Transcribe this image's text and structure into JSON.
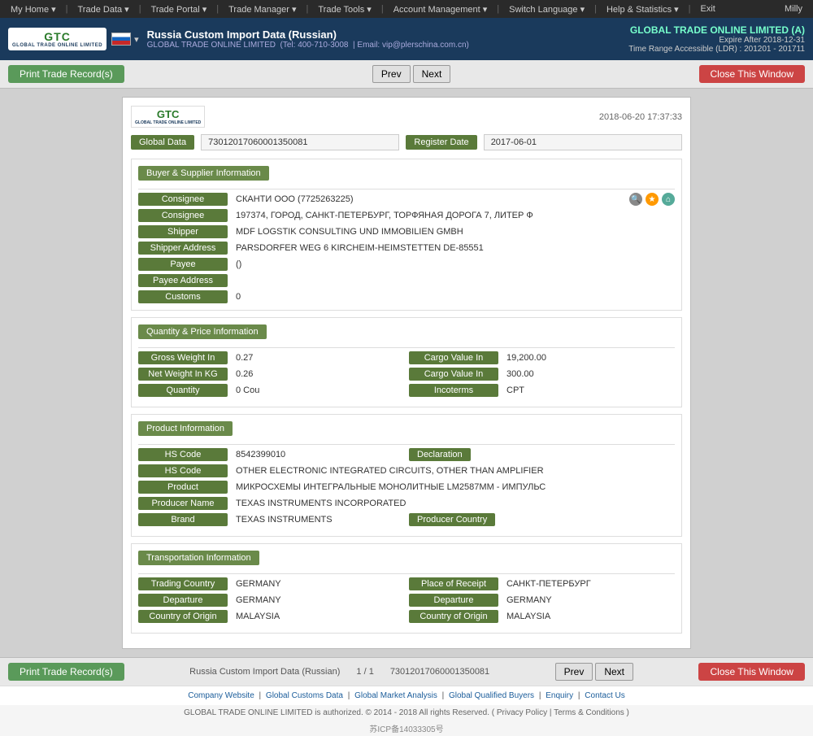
{
  "topnav": {
    "items": [
      "My Home",
      "Trade Data",
      "Trade Portal",
      "Trade Manager",
      "Trade Tools",
      "Account Management",
      "Switch Language",
      "Help & Statistics",
      "Exit"
    ],
    "user": "Milly"
  },
  "header": {
    "country_title": "Russia Custom Import Data (Russian)",
    "company_name": "GLOBAL TRADE ONLINE LIMITED",
    "tel": "Tel: 400-710-3008",
    "email": "Email: vip@plerschina.com.cn",
    "gto_link": "GLOBAL TRADE ONLINE LIMITED (A)",
    "expire": "Expire After 2018-12-31",
    "time_range": "Time Range Accessible (LDR) : 201201 - 201711"
  },
  "toolbar": {
    "print_btn": "Print Trade Record(s)",
    "prev_btn": "Prev",
    "next_btn": "Next",
    "close_btn": "Close This Window"
  },
  "record": {
    "timestamp": "2018-06-20 17:37:33",
    "global_data_label": "Global Data",
    "global_data_value": "73012017060001350081",
    "register_date_label": "Register Date",
    "register_date_value": "2017-06-01",
    "sections": {
      "buyer_supplier": {
        "title": "Buyer & Supplier Information",
        "rows": [
          {
            "label": "Consignee",
            "value": "СКАНТИ ООО (7725263225)",
            "icons": true
          },
          {
            "label": "Consignee",
            "value": "197374, ГОРОД, САНКТ-ПЕТЕРБУРГ, ТОРФЯНАЯ ДОРОГА 7, ЛИТЕР Ф"
          },
          {
            "label": "Shipper",
            "value": "MDF LOGSTIK CONSULTING UND IMMOBILIEN GMBH"
          },
          {
            "label": "Shipper Address",
            "value": "PARSDORFER WEG 6 KIRCHEIM-HEIMSTETTEN DE-85551"
          },
          {
            "label": "Payee",
            "value": "()"
          },
          {
            "label": "Payee Address",
            "value": ""
          },
          {
            "label": "Customs",
            "value": "0"
          }
        ]
      },
      "quantity_price": {
        "title": "Quantity & Price Information",
        "rows_left": [
          {
            "label": "Gross Weight In",
            "value": "0.27"
          },
          {
            "label": "Net Weight In KG",
            "value": "0.26"
          },
          {
            "label": "Quantity",
            "value": "0.000)"
          }
        ],
        "rows_right": [
          {
            "label": "Cargo Value In",
            "value": "19,200.00"
          },
          {
            "label": "Cargo Value In",
            "value": "300.00"
          },
          {
            "label": "Incoterms",
            "value": "CPT"
          }
        ]
      },
      "product": {
        "title": "Product Information",
        "hs_code_label": "HS Code",
        "hs_code_value": "8542399010",
        "declaration_btn": "Declaration",
        "hs_desc_label": "HS Code",
        "hs_desc_value": "OTHER ELECTRONIC INTEGRATED CIRCUITS, OTHER THAN AMPLIFIER",
        "product_label": "Product",
        "product_value": "МИКРОСХЕМЫ ИНТЕГРАЛЬНЫЕ МОНОЛИТНЫЕ LM2587MM - ИМПУЛЬС",
        "producer_name_label": "Producer Name",
        "producer_name_value": "TEXAS INSTRUMENTS INCORPORATED",
        "brand_label": "Brand",
        "brand_value": "TEXAS INSTRUMENTS",
        "producer_country_btn": "Producer Country"
      },
      "transportation": {
        "title": "Transportation Information",
        "rows": [
          {
            "label_left": "Trading Country",
            "value_left": "GERMANY",
            "label_right": "Place of Receipt",
            "value_right": "САНКТ-ПЕТЕРБУРГ"
          },
          {
            "label_left": "Departure",
            "value_left": "GERMANY",
            "label_right": "Departure",
            "value_right": "GERMANY"
          },
          {
            "label_left": "Country of Origin",
            "value_left": "MALAYSIA",
            "label_right": "Country of Origin",
            "value_right": "MALAYSIA"
          }
        ]
      }
    }
  },
  "footer": {
    "source": "Russia Custom Import Data (Russian)",
    "page": "1 / 1",
    "record_id": "73012017060001350081",
    "print_btn": "Print Trade Record(s)",
    "prev_btn": "Prev",
    "next_btn": "Next",
    "close_btn": "Close This Window"
  },
  "bottom_links": {
    "items": [
      "Company Website",
      "Global Customs Data",
      "Global Market Analysis",
      "Global Qualified Buyers",
      "Enquiry",
      "Contact Us"
    ],
    "copyright": "GLOBAL TRADE ONLINE LIMITED is authorized. © 2014 - 2018 All rights Reserved. ( Privacy Policy | Terms & Conditions )",
    "icp": "苏ICP备14033305号"
  }
}
